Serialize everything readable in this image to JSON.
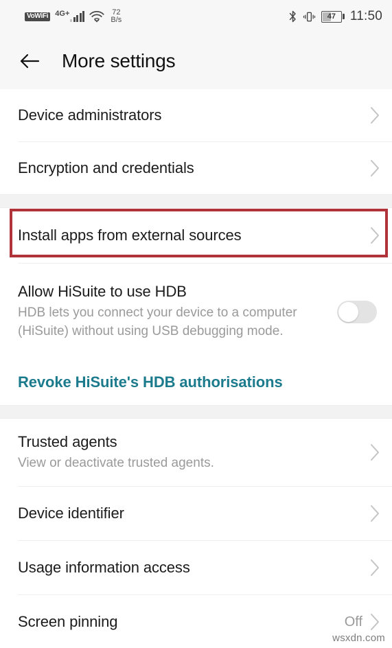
{
  "status_bar": {
    "vowifi_label": "VoWiFi",
    "network_label": "4G+",
    "wifi_icon": "wifi-icon",
    "data_speed_value": "72",
    "data_speed_unit": "B/s",
    "bluetooth_icon": "bluetooth-icon",
    "vibrate_icon": "vibrate-icon",
    "battery_percent": "47",
    "time": "11:50"
  },
  "header": {
    "back_icon": "back-arrow-icon",
    "title": "More settings"
  },
  "sections": [
    {
      "rows": [
        {
          "title": "Device administrators",
          "subtitle": "",
          "accessory": "chevron"
        },
        {
          "title": "Encryption and credentials",
          "subtitle": "",
          "accessory": "chevron"
        }
      ]
    },
    {
      "rows": [
        {
          "title": "Install apps from external sources",
          "subtitle": "",
          "accessory": "chevron",
          "highlighted": true
        },
        {
          "title": "Allow HiSuite to use HDB",
          "subtitle": "HDB lets you connect your device to a computer (HiSuite) without using USB debugging mode.",
          "accessory": "toggle",
          "toggle_on": false
        },
        {
          "title": "Revoke HiSuite's HDB authorisations",
          "subtitle": "",
          "accessory": "link"
        }
      ]
    },
    {
      "rows": [
        {
          "title": "Trusted agents",
          "subtitle": "View or deactivate trusted agents.",
          "accessory": "chevron"
        },
        {
          "title": "Device identifier",
          "subtitle": "",
          "accessory": "chevron"
        },
        {
          "title": "Usage information access",
          "subtitle": "",
          "accessory": "chevron"
        },
        {
          "title": "Screen pinning",
          "subtitle": "",
          "accessory": "chevron",
          "value": "Off"
        }
      ]
    }
  ],
  "annotation": {
    "highlight_color": "#b0333a",
    "target_row": "Install apps from external sources"
  },
  "watermark": "wsxdn.com",
  "colors": {
    "link_teal": "#1b7b8c",
    "header_bg": "#f7f7f7",
    "section_gap": "#f2f2f2"
  }
}
